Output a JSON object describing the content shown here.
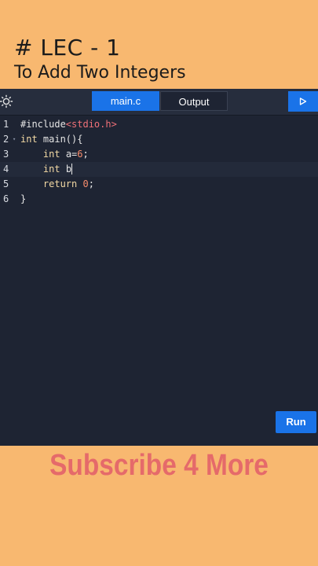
{
  "header": {
    "title": "# LEC - 1",
    "subtitle": "To Add Two Integers"
  },
  "toolbar": {
    "theme_icon": "sun-icon",
    "tabs": [
      {
        "label": "main.c",
        "active": true
      },
      {
        "label": "Output",
        "active": false
      }
    ],
    "run_icon": "play-icon"
  },
  "editor": {
    "lines": [
      {
        "number": "1",
        "tokens": [
          {
            "t": "#include",
            "c": "pp"
          },
          {
            "t": "<stdio.h>",
            "c": "str"
          }
        ]
      },
      {
        "number": "2",
        "fold": true,
        "tokens": [
          {
            "t": "int",
            "c": "kw"
          },
          {
            "t": " main(){",
            "c": "pl"
          }
        ]
      },
      {
        "number": "3",
        "tokens": [
          {
            "t": "    ",
            "c": "pl"
          },
          {
            "t": "int",
            "c": "kw"
          },
          {
            "t": " a=",
            "c": "pl"
          },
          {
            "t": "6",
            "c": "num"
          },
          {
            "t": ";",
            "c": "pl"
          }
        ]
      },
      {
        "number": "4",
        "active": true,
        "cursor": true,
        "tokens": [
          {
            "t": "    ",
            "c": "pl"
          },
          {
            "t": "int",
            "c": "kw"
          },
          {
            "t": " b",
            "c": "pl"
          }
        ]
      },
      {
        "number": "5",
        "tokens": [
          {
            "t": "    ",
            "c": "pl"
          },
          {
            "t": "return",
            "c": "kw"
          },
          {
            "t": " ",
            "c": "pl"
          },
          {
            "t": "0",
            "c": "num"
          },
          {
            "t": ";",
            "c": "pl"
          }
        ]
      },
      {
        "number": "6",
        "tokens": [
          {
            "t": "}",
            "c": "pl"
          }
        ]
      }
    ]
  },
  "run_button_label": "Run",
  "banner": "Subscribe 4 More",
  "colors": {
    "background": "#f8b870",
    "editor_bg": "#1e2433",
    "accent": "#1a73e8",
    "banner_text": "#e56a6a"
  }
}
